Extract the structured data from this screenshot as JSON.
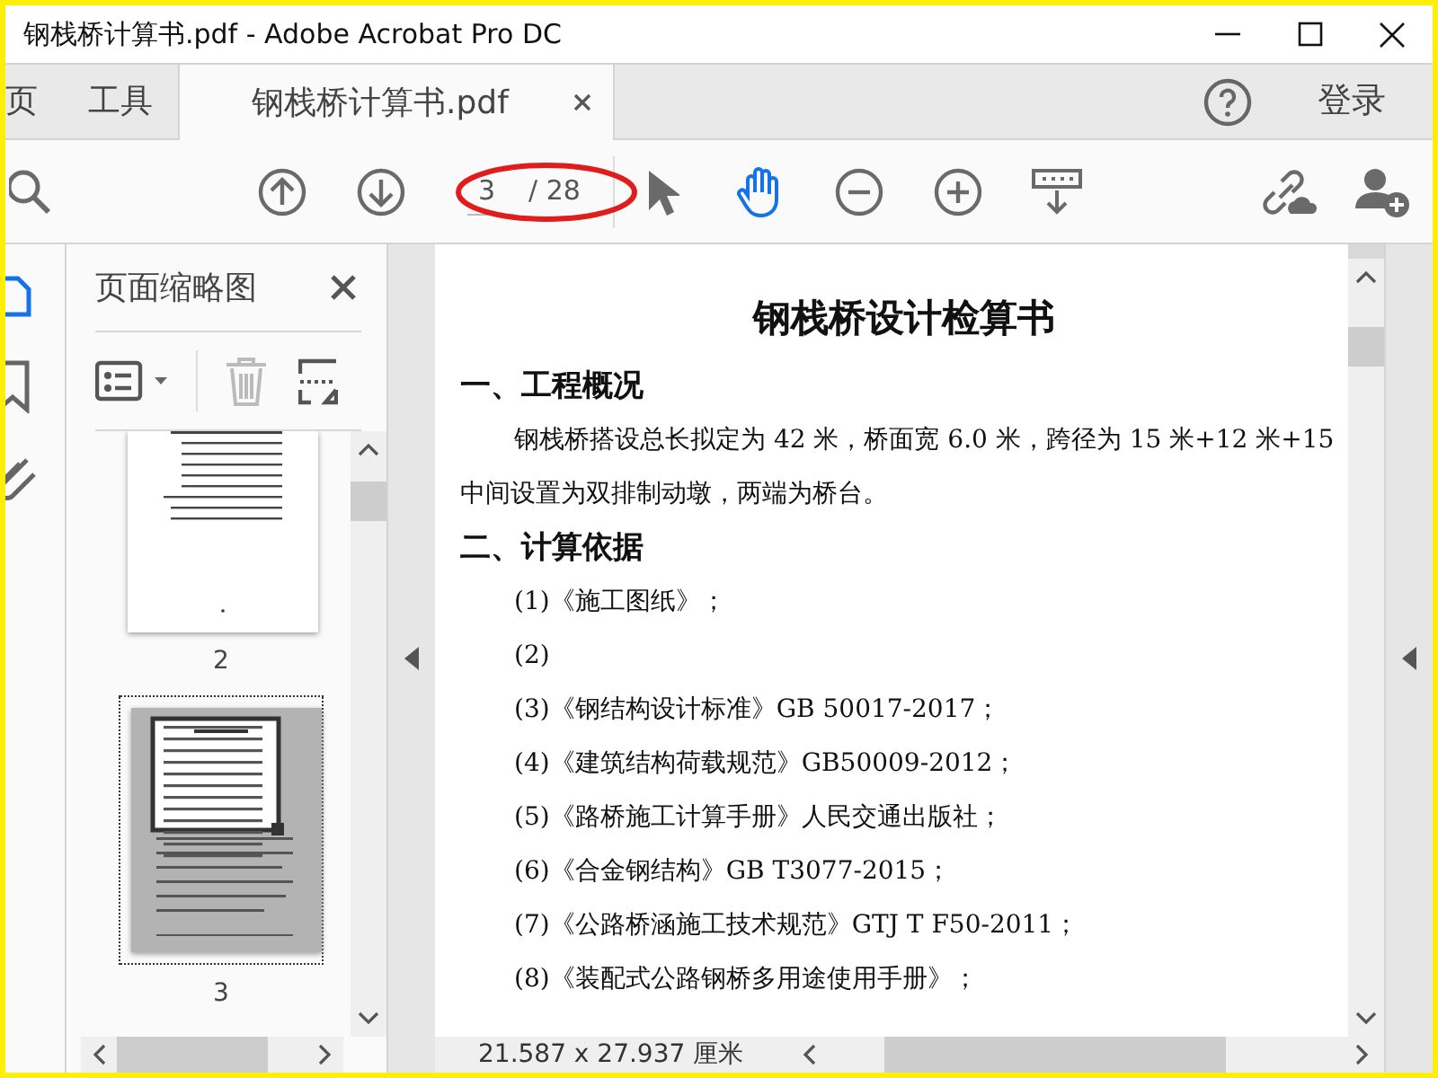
{
  "window": {
    "title": "钢栈桥计算书.pdf - Adobe Acrobat Pro DC"
  },
  "tabs": [
    {
      "label": "页",
      "selected": false
    },
    {
      "label": "工具",
      "selected": false
    },
    {
      "label": "钢栈桥计算书.pdf",
      "selected": true,
      "closable": true
    }
  ],
  "account": {
    "login": "登录"
  },
  "toolbar": {
    "page_field": {
      "value": "3"
    },
    "page_total": "/ 28",
    "tools": [
      {
        "kind": "search",
        "selected": false
      },
      {
        "kind": "prev",
        "selected": false
      },
      {
        "kind": "next",
        "selected": false
      },
      {
        "kind": "page"
      },
      {
        "kind": "select",
        "selected": false
      },
      {
        "kind": "hand",
        "selected": true
      },
      {
        "kind": "zoom_out",
        "selected": false
      },
      {
        "kind": "zoom_in",
        "selected": false
      },
      {
        "kind": "keyboard",
        "selected": false
      },
      {
        "kind": "gap"
      },
      {
        "kind": "share",
        "selected": false
      },
      {
        "kind": "user_add",
        "selected": false
      }
    ]
  },
  "rail": [
    {
      "kind": "pages",
      "selected": true
    },
    {
      "kind": "bookmarks",
      "selected": false
    },
    {
      "kind": "attachments",
      "selected": false
    }
  ],
  "sidebar": {
    "title": "页面缩略图",
    "thumbnails": [
      {
        "label": "2",
        "selected": false
      },
      {
        "label": "3",
        "selected": true
      }
    ]
  },
  "document": {
    "title": "钢栈桥设计检算书",
    "sections": [
      {
        "heading": "一、工程概况",
        "lines": [
          "钢栈桥搭设总长拟定为 42 米，桥面宽 6.0 米，跨径为 15 米+12 米+15",
          "中间设置为双排制动墩，两端为桥台。"
        ],
        "first_indent": true
      },
      {
        "heading": "二、计算依据",
        "items": [
          "(1)《施工图纸》；",
          "(2)",
          "(3)《钢结构设计标准》GB 50017-2017；",
          "(4)《建筑结构荷载规范》GB50009-2012；",
          "(5)《路桥施工计算手册》人民交通出版社；",
          "(6)《合金钢结构》GB T3077-2015；",
          "(7)《公路桥涵施工技术规范》GTJ T F50-2011；",
          "(8)《装配式公路钢桥多用途使用手册》；"
        ]
      }
    ]
  },
  "status_bar": {
    "page_size": "21.587 x 27.937 厘米"
  }
}
